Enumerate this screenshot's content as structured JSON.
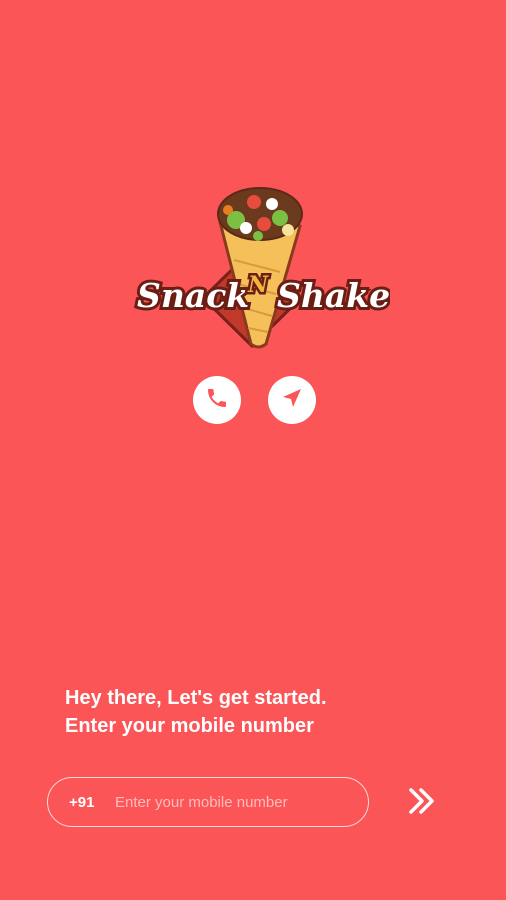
{
  "brand": {
    "logo_text_left": "Snack",
    "logo_text_mid": "N",
    "logo_text_right": "Shake"
  },
  "actions": {
    "call_icon": "phone-icon",
    "navigate_icon": "navigation-arrow-icon"
  },
  "greeting": {
    "line1": "Hey there, Let's get started.",
    "line2": "Enter your mobile number"
  },
  "login": {
    "country_code": "+91",
    "phone_placeholder": "Enter your mobile number",
    "phone_value": "",
    "submit_icon": "double-chevron-right-icon"
  },
  "colors": {
    "background": "#fb5557",
    "icon_color": "#fb5557",
    "text": "#ffffff"
  }
}
